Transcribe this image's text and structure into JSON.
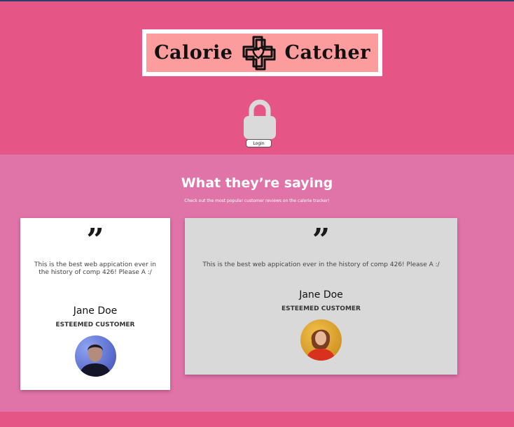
{
  "header": {
    "logo_left": "Calorie",
    "logo_right": "Catcher",
    "login_label": "Login"
  },
  "testimonials": {
    "title": "What they’re saying",
    "subtitle": "Check out the most popular customer reviews on the calorie tracker!",
    "cards": [
      {
        "quote_mark": "”",
        "text": "This is the best web appication ever in the history of comp 426! Please A :/",
        "name": "Jane Doe",
        "role": "ESTEEMED CUSTOMER"
      },
      {
        "quote_mark": "”",
        "text": "This is the best web appication ever in the history of comp 426! Please A :/",
        "name": "Jane Doe",
        "role": "ESTEEMED CUSTOMER"
      }
    ]
  },
  "colors": {
    "header_bg": "#e55585",
    "section_bg": "#e073a8",
    "logo_bg": "#fd9c9c",
    "card2_bg": "#d9d9d9"
  }
}
